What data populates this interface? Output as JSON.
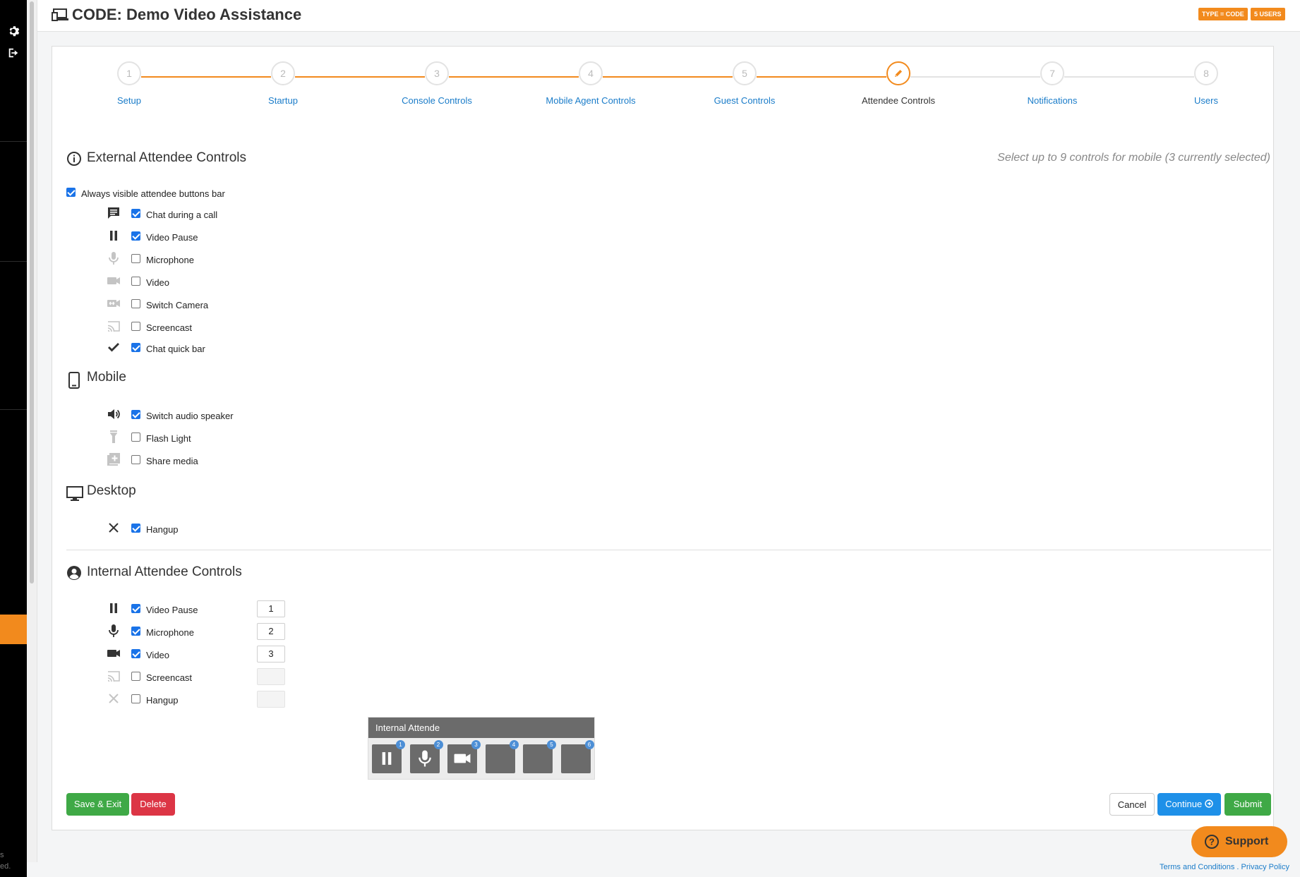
{
  "header": {
    "title": "CODE: Demo Video Assistance",
    "badges": [
      "TYPE = CODE",
      "5 USERS"
    ]
  },
  "sidebar": {
    "items": [
      {
        "icon": "gear-icon"
      },
      {
        "icon": "sign-out-icon"
      }
    ],
    "bottom_text": [
      "s",
      "ed."
    ]
  },
  "steps": [
    {
      "number": "1",
      "label": "Setup",
      "state": "done"
    },
    {
      "number": "2",
      "label": "Startup",
      "state": "done"
    },
    {
      "number": "3",
      "label": "Console Controls",
      "state": "done"
    },
    {
      "number": "4",
      "label": "Mobile Agent Controls",
      "state": "done"
    },
    {
      "number": "5",
      "label": "Guest Controls",
      "state": "done"
    },
    {
      "number": "6",
      "label": "Attendee Controls",
      "state": "active"
    },
    {
      "number": "7",
      "label": "Notifications",
      "state": "todo"
    },
    {
      "number": "8",
      "label": "Users",
      "state": "todo"
    }
  ],
  "external": {
    "title": "External Attendee Controls",
    "note": "Select up to 9 controls for mobile (3 currently selected)",
    "always_visible": {
      "label": "Always visible attendee buttons bar",
      "checked": true
    },
    "controls": [
      {
        "label": "Chat during a call",
        "checked": true,
        "icon": "chat-icon"
      },
      {
        "label": "Video Pause",
        "checked": true,
        "icon": "pause-icon"
      },
      {
        "label": "Microphone",
        "checked": false,
        "icon": "microphone-icon"
      },
      {
        "label": "Video",
        "checked": false,
        "icon": "video-camera-icon"
      },
      {
        "label": "Switch Camera",
        "checked": false,
        "icon": "switch-camera-icon"
      },
      {
        "label": "Screencast",
        "checked": false,
        "icon": "cast-icon"
      },
      {
        "label": "Chat quick bar",
        "checked": true,
        "icon": "checkmark-icon"
      }
    ]
  },
  "mobile": {
    "title": "Mobile",
    "controls": [
      {
        "label": "Switch audio speaker",
        "checked": true,
        "icon": "speaker-icon"
      },
      {
        "label": "Flash Light",
        "checked": false,
        "icon": "flashlight-icon"
      },
      {
        "label": "Share media",
        "checked": false,
        "icon": "share-media-icon"
      }
    ]
  },
  "desktop": {
    "title": "Desktop",
    "controls": [
      {
        "label": "Hangup",
        "checked": true,
        "icon": "close-icon"
      }
    ]
  },
  "internal": {
    "title": "Internal Attendee Controls",
    "controls": [
      {
        "label": "Video Pause",
        "checked": true,
        "order": "1",
        "icon": "pause-icon"
      },
      {
        "label": "Microphone",
        "checked": true,
        "order": "2",
        "icon": "microphone-icon"
      },
      {
        "label": "Video",
        "checked": true,
        "order": "3",
        "icon": "video-camera-icon"
      },
      {
        "label": "Screencast",
        "checked": false,
        "order": "",
        "icon": "cast-icon"
      },
      {
        "label": "Hangup",
        "checked": false,
        "order": "",
        "icon": "close-icon"
      }
    ]
  },
  "preview": {
    "title": "Internal Attende",
    "buttons": [
      {
        "number": "1",
        "icon": "pause-icon"
      },
      {
        "number": "2",
        "icon": "microphone-icon"
      },
      {
        "number": "3",
        "icon": "video-camera-icon"
      },
      {
        "number": "4",
        "icon": ""
      },
      {
        "number": "5",
        "icon": ""
      },
      {
        "number": "6",
        "icon": ""
      }
    ]
  },
  "actions": {
    "save_exit": "Save & Exit",
    "delete": "Delete",
    "cancel": "Cancel",
    "continue": "Continue",
    "submit": "Submit"
  },
  "support": {
    "label": "Support"
  },
  "footer": {
    "terms": "Terms and Conditions",
    "separator": " . ",
    "privacy": "Privacy Policy"
  },
  "colors": {
    "accent": "#f28a1d",
    "link": "#1a7cc9",
    "primary": "#1e90e8",
    "success": "#3fa946",
    "danger": "#dc3545"
  }
}
